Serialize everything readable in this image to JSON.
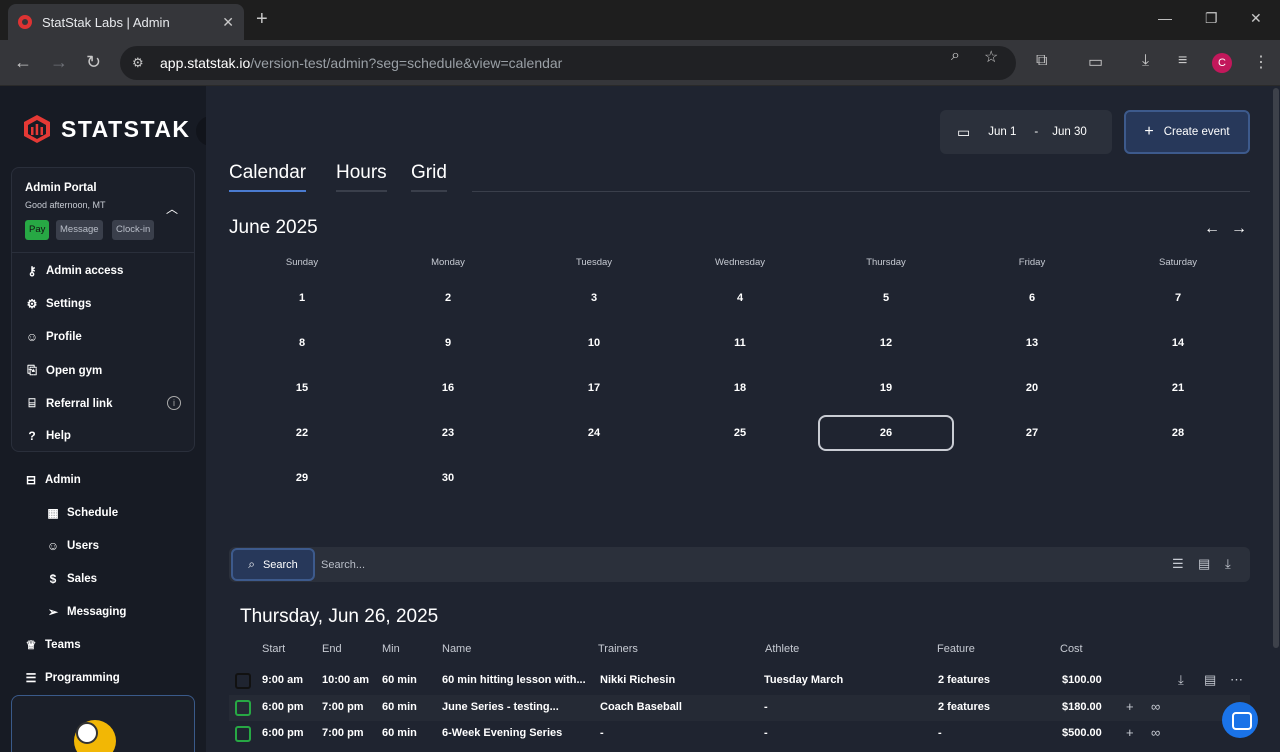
{
  "browser": {
    "tab_title": "StatStak Labs | Admin",
    "url_host": "app.statstak.io",
    "url_path": "/version-test/admin?seg=schedule&view=calendar",
    "profile_initial": "C"
  },
  "sidebar": {
    "brand": "STATSTAK",
    "portal": {
      "title": "Admin Portal",
      "greeting": "Good afternoon, MT",
      "pills": [
        "Pay",
        "Message",
        "Clock-in"
      ],
      "items": [
        {
          "label": "Admin access",
          "icon": "key-icon"
        },
        {
          "label": "Settings",
          "icon": "gear-icon"
        },
        {
          "label": "Profile",
          "icon": "user-icon"
        },
        {
          "label": "Open gym",
          "icon": "door-icon"
        },
        {
          "label": "Referral link",
          "icon": "gift-icon"
        },
        {
          "label": "Help",
          "icon": "help-icon"
        }
      ]
    },
    "nav": [
      {
        "label": "Admin",
        "icon": "briefcase-icon"
      },
      {
        "label": "Schedule",
        "icon": "calendar-icon"
      },
      {
        "label": "Users",
        "icon": "users-icon"
      },
      {
        "label": "Sales",
        "icon": "dollar-icon"
      },
      {
        "label": "Messaging",
        "icon": "send-icon"
      },
      {
        "label": "Teams",
        "icon": "trophy-icon"
      },
      {
        "label": "Programming",
        "icon": "clipboard-icon"
      }
    ]
  },
  "header": {
    "date_from": "Jun 1",
    "date_sep": "-",
    "date_to": "Jun 30",
    "create_label": "Create event"
  },
  "tabs": [
    "Calendar",
    "Hours",
    "Grid"
  ],
  "calendar": {
    "month_title": "June 2025",
    "weekdays": [
      "Sunday",
      "Monday",
      "Tuesday",
      "Wednesday",
      "Thursday",
      "Friday",
      "Saturday"
    ],
    "days": [
      "1",
      "2",
      "3",
      "4",
      "5",
      "6",
      "7",
      "8",
      "9",
      "10",
      "11",
      "12",
      "13",
      "14",
      "15",
      "16",
      "17",
      "18",
      "19",
      "20",
      "21",
      "22",
      "23",
      "24",
      "25",
      "26",
      "27",
      "28",
      "29",
      "30"
    ],
    "selected_day": "26"
  },
  "search": {
    "button_label": "Search",
    "placeholder": "Search..."
  },
  "events": {
    "date_title": "Thursday, Jun 26, 2025",
    "columns": [
      "Start",
      "End",
      "Min",
      "Name",
      "Trainers",
      "Athlete",
      "Feature",
      "Cost"
    ],
    "rows": [
      {
        "start": "9:00 am",
        "end": "10:00 am",
        "min": "60 min",
        "name": "60 min hitting lesson with...",
        "trainers": "Nikki Richesin",
        "athlete": "Tuesday March",
        "feature": "2 features",
        "cost": "$100.00"
      },
      {
        "start": "6:00 pm",
        "end": "7:00 pm",
        "min": "60 min",
        "name": "June Series - testing...",
        "trainers": "Coach Baseball",
        "athlete": "-",
        "feature": "2 features",
        "cost": "$180.00"
      },
      {
        "start": "6:00 pm",
        "end": "7:00 pm",
        "min": "60 min",
        "name": "6-Week Evening Series",
        "trainers": "-",
        "athlete": "-",
        "feature": "-",
        "cost": "$500.00"
      }
    ]
  },
  "colors": {
    "accent": "#4a7bd0",
    "primary_button": "#27385a",
    "success": "#27a844",
    "brand": "#e53935"
  }
}
